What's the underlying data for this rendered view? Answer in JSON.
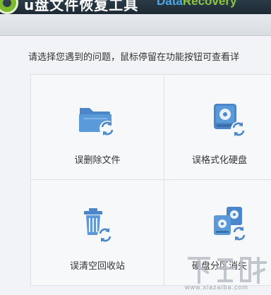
{
  "titlebar": {
    "title_cn": "u盘文件恢复工具",
    "title_en_part1": "Data",
    "title_en_part2": "Recovery",
    "logo_icon": "green-circle-logo-icon"
  },
  "colors": {
    "accent_blue": "#4a8fd6",
    "accent_green": "#8cc63f",
    "icon_blue": "#5596d6"
  },
  "main": {
    "instruction": "请选择您遇到的问题，鼠标停留在功能按钮可查看详",
    "options": [
      {
        "label": "误删除文件",
        "icon": "folder-recover-icon"
      },
      {
        "label": "误格式化硬盘",
        "icon": "harddisk-recover-icon"
      },
      {
        "label": "误清空回收站",
        "icon": "recycle-bin-recover-icon"
      },
      {
        "label": "硬盘分区消失",
        "icon": "partition-recover-icon"
      }
    ]
  },
  "watermark": {
    "text": "www.xiazaiba.com",
    "logo_text": "下载吧"
  }
}
